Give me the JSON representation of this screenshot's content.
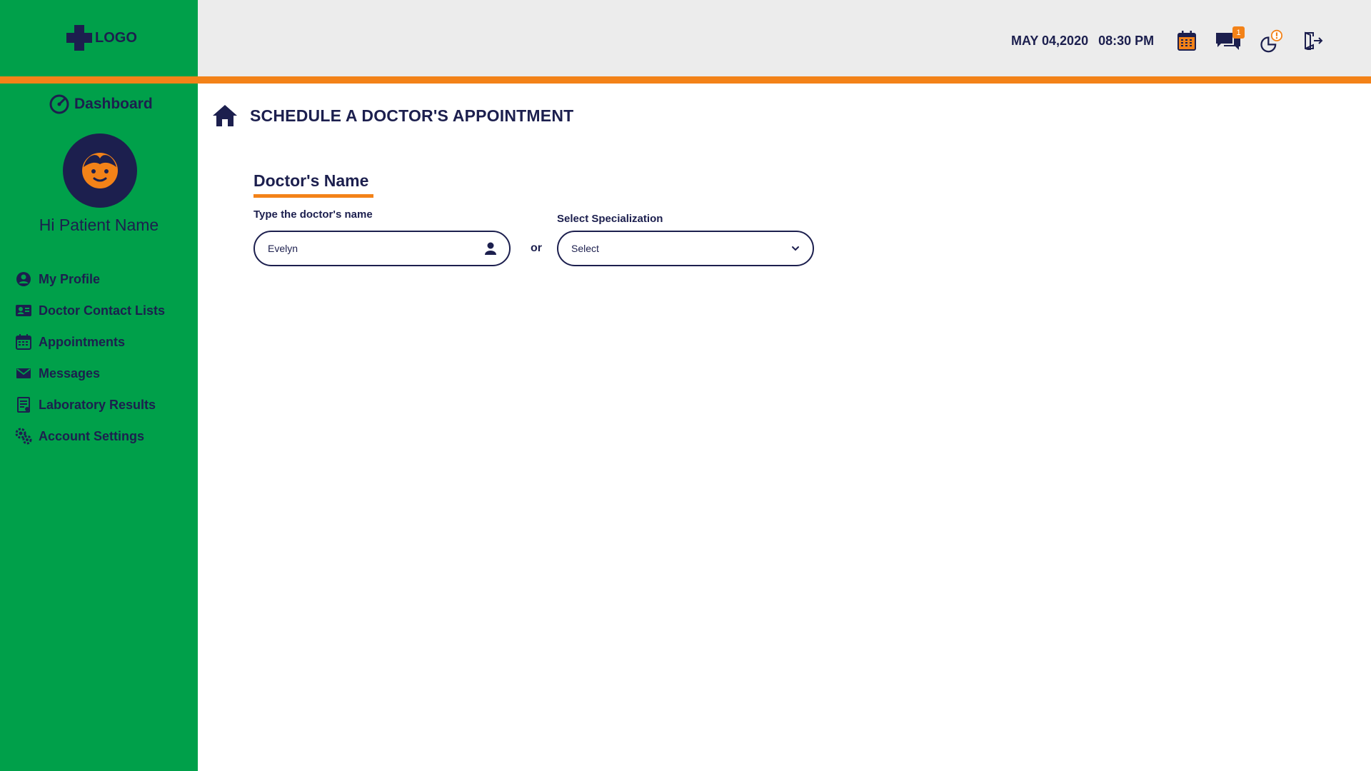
{
  "logo": {
    "text": "LOGO"
  },
  "sidebar": {
    "dashboard_label": "Dashboard",
    "greeting": "Hi Patient Name",
    "items": [
      {
        "label": "My Profile",
        "icon": "user-circle-icon"
      },
      {
        "label": "Doctor Contact Lists",
        "icon": "contact-card-icon"
      },
      {
        "label": "Appointments",
        "icon": "calendar-icon"
      },
      {
        "label": "Messages",
        "icon": "envelope-icon"
      },
      {
        "label": "Laboratory Results",
        "icon": "lab-report-icon"
      },
      {
        "label": "Account Settings",
        "icon": "gears-icon"
      }
    ]
  },
  "header": {
    "date": "MAY 04,2020",
    "time": "08:30 PM",
    "message_badge": "1"
  },
  "main": {
    "page_title": "SCHEDULE A DOCTOR'S APPOINTMENT",
    "section_title": "Doctor's Name",
    "name_label": "Type the doctor's name",
    "name_value": "Evelyn",
    "or_text": "or",
    "specialization_label": "Select Specialization",
    "specialization_value": "Select"
  },
  "colors": {
    "sidebar_green": "#00a04a",
    "accent_orange": "#f38218",
    "navy": "#1c1f4e",
    "header_gray": "#ececec"
  }
}
